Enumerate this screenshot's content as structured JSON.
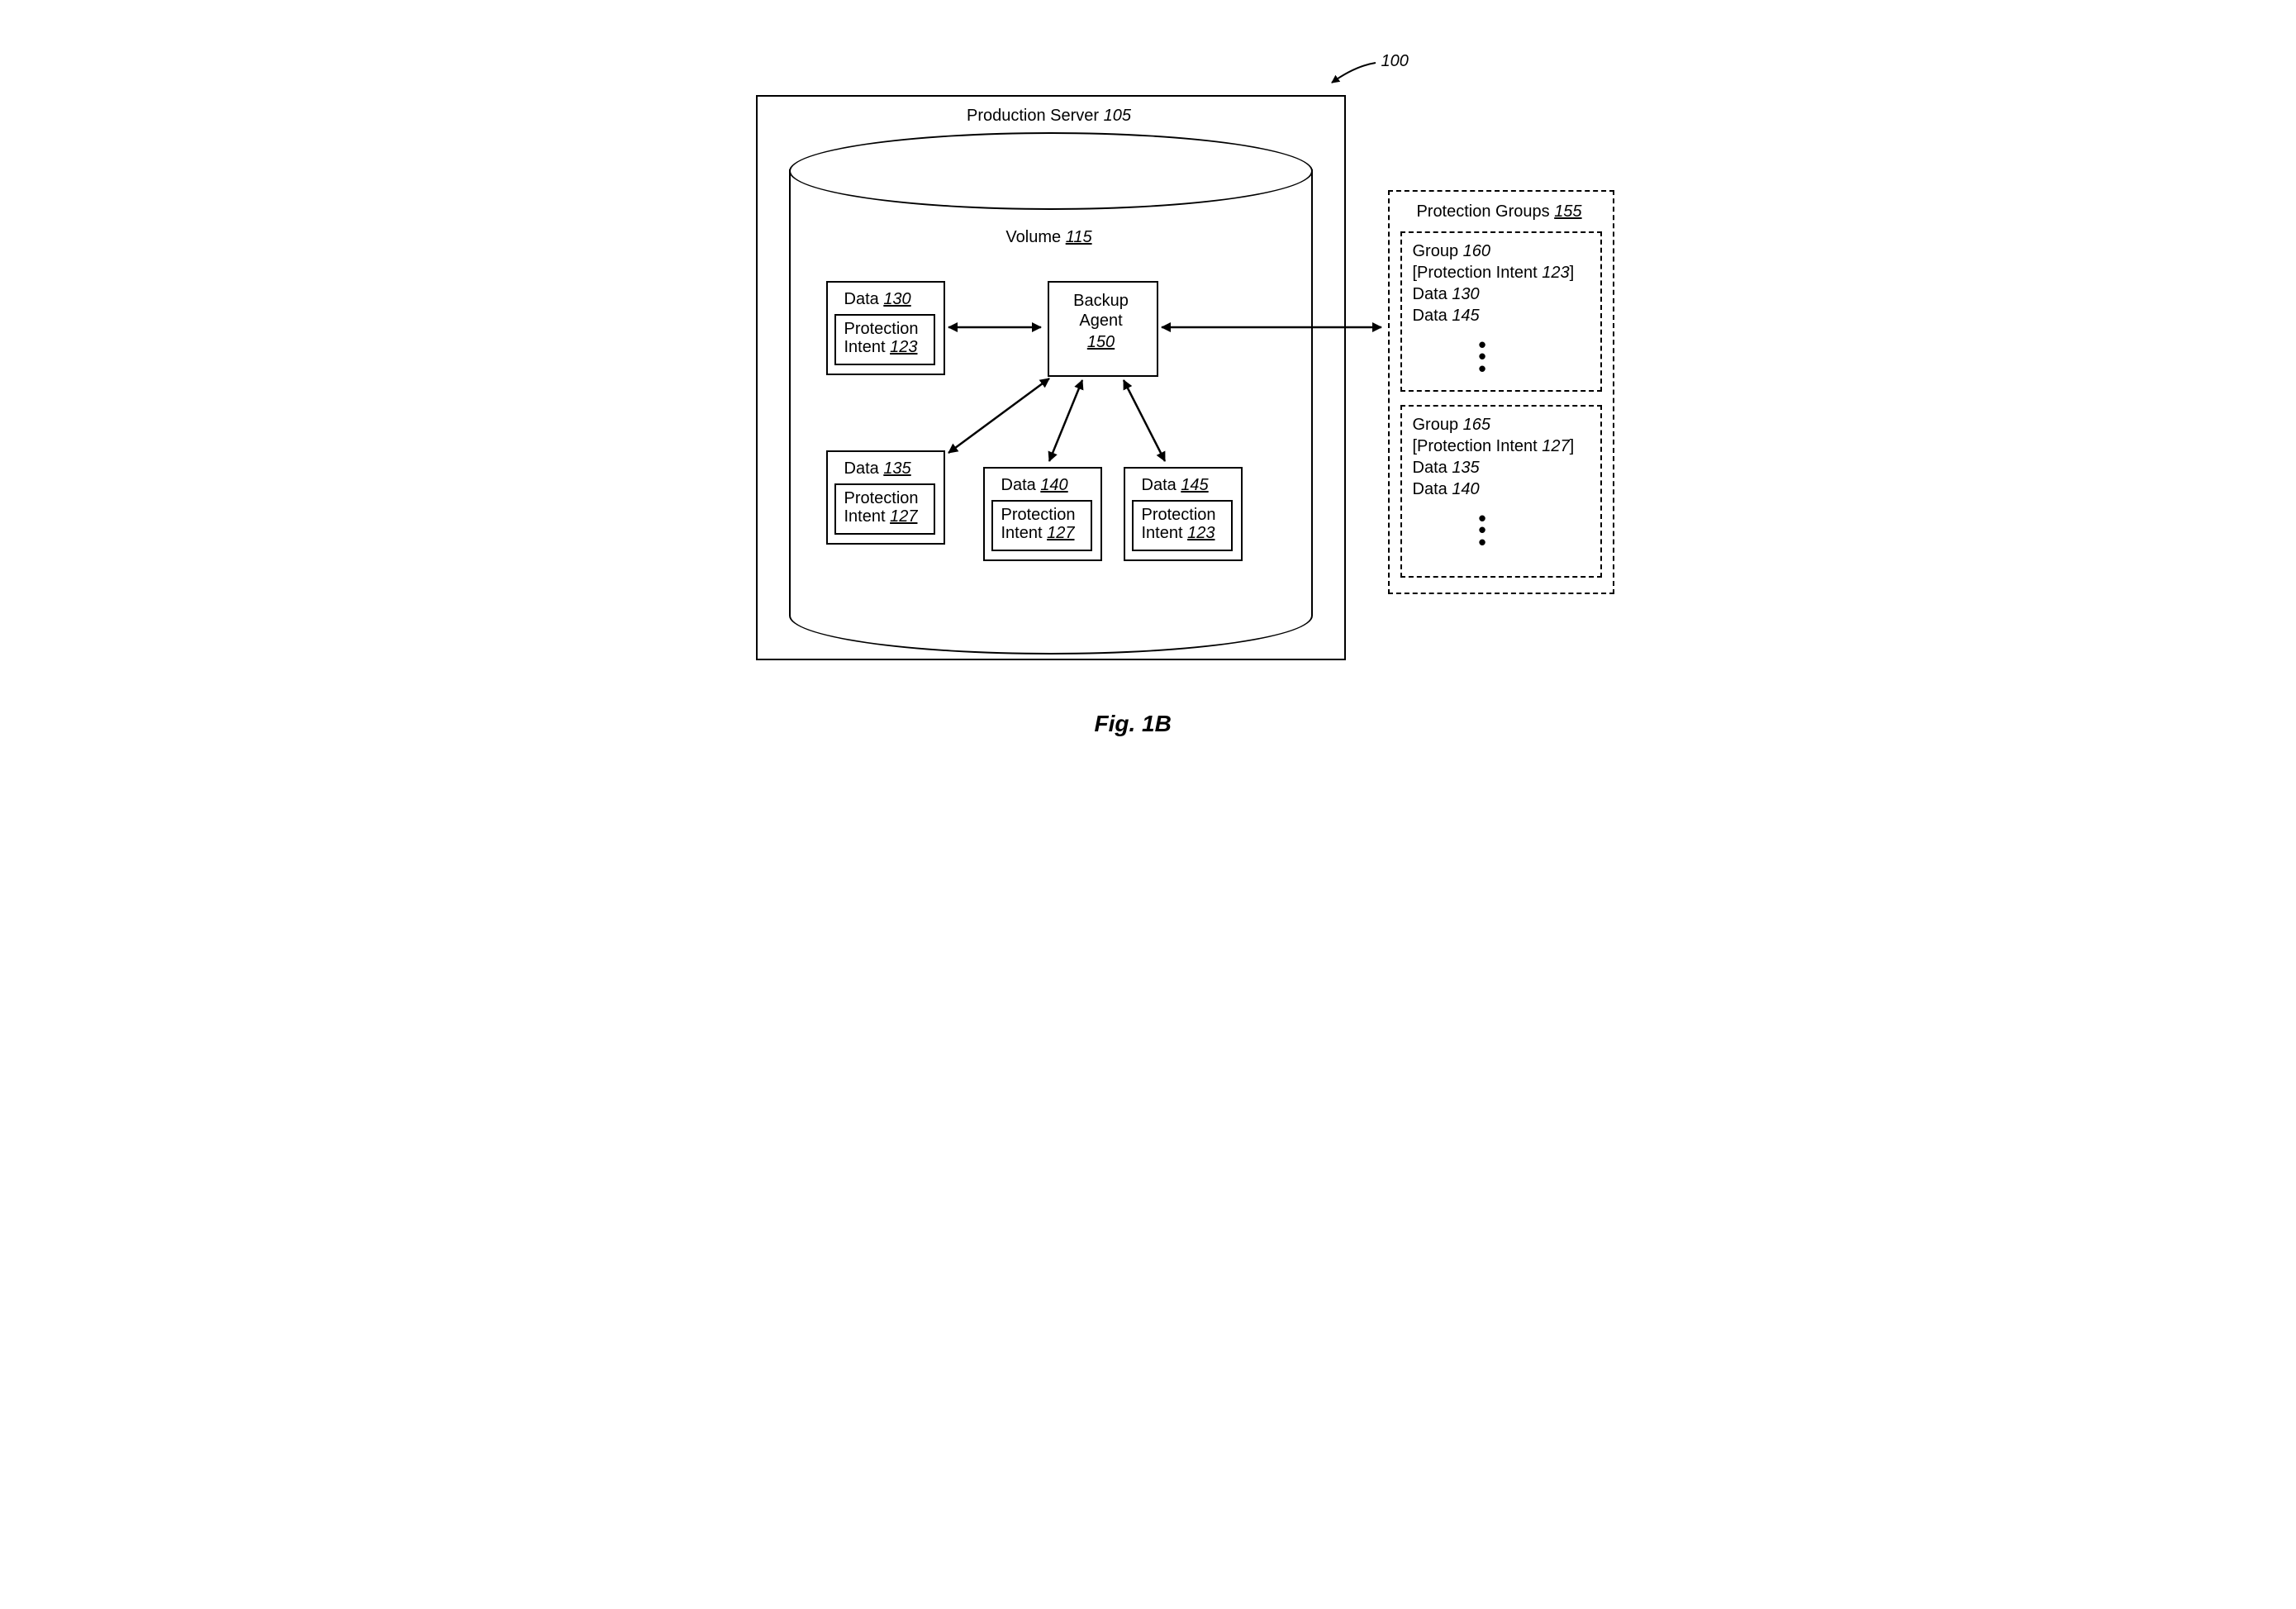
{
  "ref": {
    "label": "100"
  },
  "figure": {
    "caption": "Fig. 1B"
  },
  "server": {
    "title_a": "Production Server ",
    "title_b": "105"
  },
  "volume": {
    "title_a": "Volume ",
    "title_b": "115"
  },
  "agent": {
    "line1": "Backup",
    "line2": "Agent",
    "num": "150"
  },
  "data130": {
    "label_a": "Data ",
    "label_b": "130",
    "pi_a": "Protection",
    "pi_b": "Intent ",
    "pi_c": "123"
  },
  "data135": {
    "label_a": "Data ",
    "label_b": "135",
    "pi_a": "Protection",
    "pi_b": "Intent ",
    "pi_c": "127"
  },
  "data140": {
    "label_a": "Data ",
    "label_b": "140",
    "pi_a": "Protection",
    "pi_b": "Intent ",
    "pi_c": "127"
  },
  "data145": {
    "label_a": "Data ",
    "label_b": "145",
    "pi_a": "Protection",
    "pi_b": "Intent ",
    "pi_c": "123"
  },
  "pg": {
    "title_a": "Protection Groups ",
    "title_b": "155"
  },
  "g160": {
    "l1a": "Group ",
    "l1b": "160",
    "l2a": "[Protection Intent ",
    "l2b": "123",
    "l2c": "]",
    "l3a": "Data ",
    "l3b": "130",
    "l4a": "Data ",
    "l4b": "145"
  },
  "g165": {
    "l1a": "Group ",
    "l1b": "165",
    "l2a": "[Protection Intent ",
    "l2b": "127",
    "l2c": "]",
    "l3a": "Data ",
    "l3b": "135",
    "l4a": "Data ",
    "l4b": "140"
  }
}
